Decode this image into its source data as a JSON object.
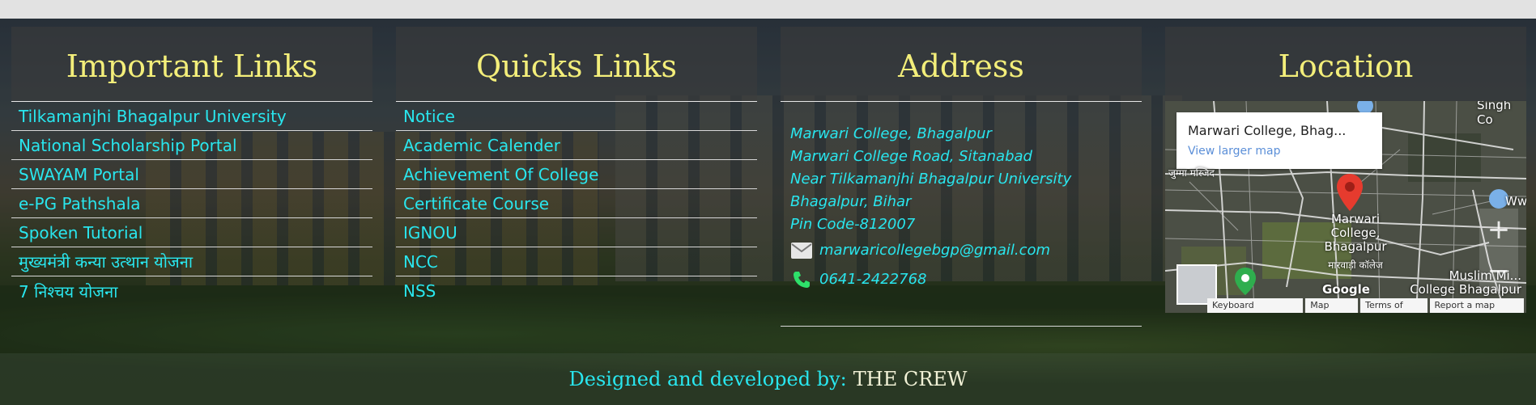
{
  "important_links": {
    "heading": "Important Links",
    "items": [
      "Tilkamanjhi Bhagalpur University",
      "National Scholarship Portal",
      "SWAYAM Portal",
      "e-PG Pathshala",
      "Spoken Tutorial",
      "मुख्यमंत्री कन्या उत्थान योजना",
      "7 निश्चय योजना"
    ]
  },
  "quick_links": {
    "heading": "Quicks Links",
    "items": [
      "Notice",
      "Academic Calender",
      "Achievement Of College",
      "Certificate Course",
      "IGNOU",
      "NCC",
      "NSS"
    ]
  },
  "address": {
    "heading": "Address",
    "lines": [
      "Marwari College, Bhagalpur",
      "Marwari College Road, Sitanabad",
      "Near Tilkamanjhi Bhagalpur University",
      "Bhagalpur, Bihar",
      "Pin Code-812007"
    ],
    "email": "marwaricollegebgp@gmail.com",
    "phone": "0641-2422768",
    "email_icon": "envelope-icon",
    "phone_icon": "phone-icon"
  },
  "location": {
    "heading": "Location",
    "map": {
      "place_name": "Marwari College, Bhag...",
      "view_larger": "View larger map",
      "labels": {
        "marker": "Marwari College, Bhagalpur",
        "hindi": "मारवाड़ी कॉलेज",
        "muslim": "Muslim Mi... College Bhagalpur",
        "singh": "Singh Co",
        "masjid": "जुम्मा मस्जिद",
        "www": "Www",
        "google": "Google"
      },
      "zoom_in": "+",
      "zoom_out": "−",
      "attribution": [
        "Keyboard shortcuts",
        "Map Data",
        "Terms of Use",
        "Report a map error"
      ]
    }
  },
  "footer": {
    "label": "Designed and developed by:",
    "crew": "THE CREW"
  },
  "colors": {
    "heading": "#f3ee7a",
    "link": "#29e6ee"
  }
}
